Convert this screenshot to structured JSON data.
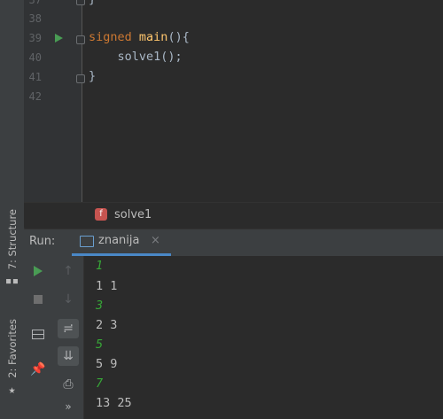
{
  "editor": {
    "lines": [
      {
        "num": "37",
        "text": "}"
      },
      {
        "num": "38",
        "text": ""
      },
      {
        "num": "39",
        "kw": "signed",
        "fn": "main",
        "rest": "(){"
      },
      {
        "num": "40",
        "text": "    solve1();"
      },
      {
        "num": "41",
        "text": "}"
      },
      {
        "num": "42",
        "text": ""
      }
    ]
  },
  "breadcrumb": {
    "icon_letter": "f",
    "label": "solve1"
  },
  "run_panel": {
    "title": "Run:",
    "tab_label": "znanija",
    "tab_close": "×"
  },
  "console_lines": [
    {
      "text": "1",
      "type": "input"
    },
    {
      "text": "1 1",
      "type": "output"
    },
    {
      "text": "3",
      "type": "input"
    },
    {
      "text": "2 3",
      "type": "output"
    },
    {
      "text": "5",
      "type": "input"
    },
    {
      "text": "5 9",
      "type": "output"
    },
    {
      "text": "7",
      "type": "input"
    },
    {
      "text": "13 25",
      "type": "output"
    }
  ],
  "left_tabs": [
    {
      "label": "7: Structure",
      "icon": "structure-icon"
    },
    {
      "label": "2: Favorites",
      "icon": "star-icon"
    }
  ],
  "colors": {
    "keyword": "#cc7832",
    "function": "#ffc66d",
    "input_text": "#37a737",
    "run_green": "#499c54",
    "tab_underline": "#4a88c7"
  }
}
